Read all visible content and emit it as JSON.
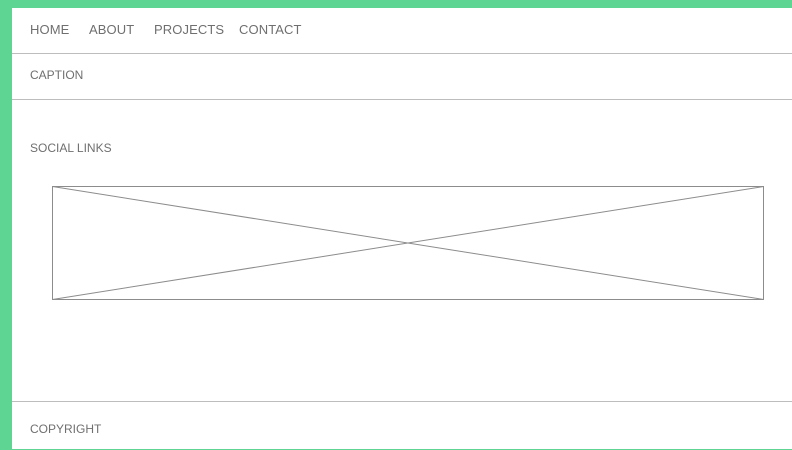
{
  "nav": {
    "items": [
      {
        "label": "HOME"
      },
      {
        "label": "ABOUT"
      },
      {
        "label": "PROJECTS"
      },
      {
        "label": "CONTACT"
      }
    ]
  },
  "caption": {
    "text": "CAPTION"
  },
  "social": {
    "label": "SOCIAL LINKS"
  },
  "placeholder": {
    "icon": "image-placeholder-icon"
  },
  "footer": {
    "text": "COPYRIGHT"
  },
  "colors": {
    "frame": "#5fd594",
    "background": "#ffffff",
    "text": "#6f6f6f",
    "divider": "#bdbdbd"
  }
}
